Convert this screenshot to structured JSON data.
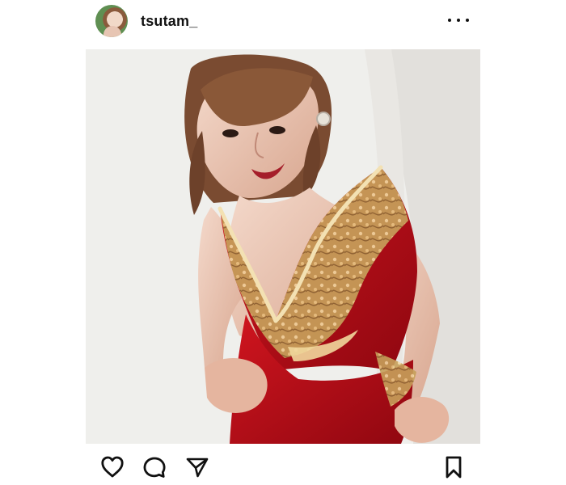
{
  "post": {
    "username": "tsutam_",
    "avatar_icon": "profile-photo-icon",
    "more_icon": "more-options-icon",
    "image_description": "",
    "actions": [
      {
        "label": "",
        "icon": "heart-icon"
      },
      {
        "label": "",
        "icon": "comment-icon"
      },
      {
        "label": "",
        "icon": "paper-plane-icon"
      },
      {
        "label": "",
        "icon": "bookmark-icon"
      }
    ]
  }
}
